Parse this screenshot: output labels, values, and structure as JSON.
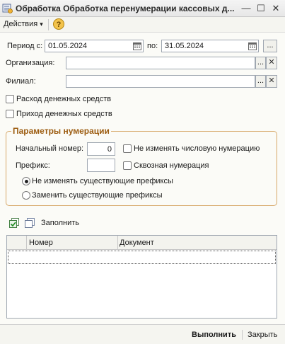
{
  "window": {
    "title": "Обработка  Обработка перенумерации кассовых д...",
    "close_glyph": "✕",
    "maximize_glyph": "☐",
    "minimize_glyph": "—"
  },
  "toolbar": {
    "actions_label": "Действия",
    "actions_arrow": "▾",
    "help_label": "?"
  },
  "period": {
    "label": "Период с:",
    "from": "01.05.2024",
    "to_label": "по:",
    "to": "31.05.2024",
    "more_label": "..."
  },
  "organization": {
    "label": "Организация:",
    "value": "",
    "select_label": "...",
    "clear_label": "✕"
  },
  "branch": {
    "label": "Филиал:",
    "value": "",
    "select_label": "...",
    "clear_label": "✕"
  },
  "checkboxes": {
    "expense_label": "Расход денежных средств",
    "expense_checked": false,
    "income_label": "Приход денежных средств",
    "income_checked": false
  },
  "numbering": {
    "title": "Параметры нумерации",
    "start_label": "Начальный номер:",
    "start_value": "0",
    "keep_numeric_label": "Не изменять числовую нумерацию",
    "keep_numeric_checked": false,
    "prefix_label": "Префикс:",
    "prefix_value": "",
    "through_label": "Сквозная нумерация",
    "through_checked": false,
    "radio_keep_label": "Не изменять существующие префиксы",
    "radio_keep_selected": true,
    "radio_replace_label": "Заменить существующие префиксы",
    "radio_replace_selected": false
  },
  "table_toolbar": {
    "fill_label": "Заполнить"
  },
  "table": {
    "columns": [
      "",
      "Номер",
      "Документ"
    ],
    "rows": []
  },
  "footer": {
    "run_label": "Выполнить",
    "close_label": "Закрыть"
  }
}
